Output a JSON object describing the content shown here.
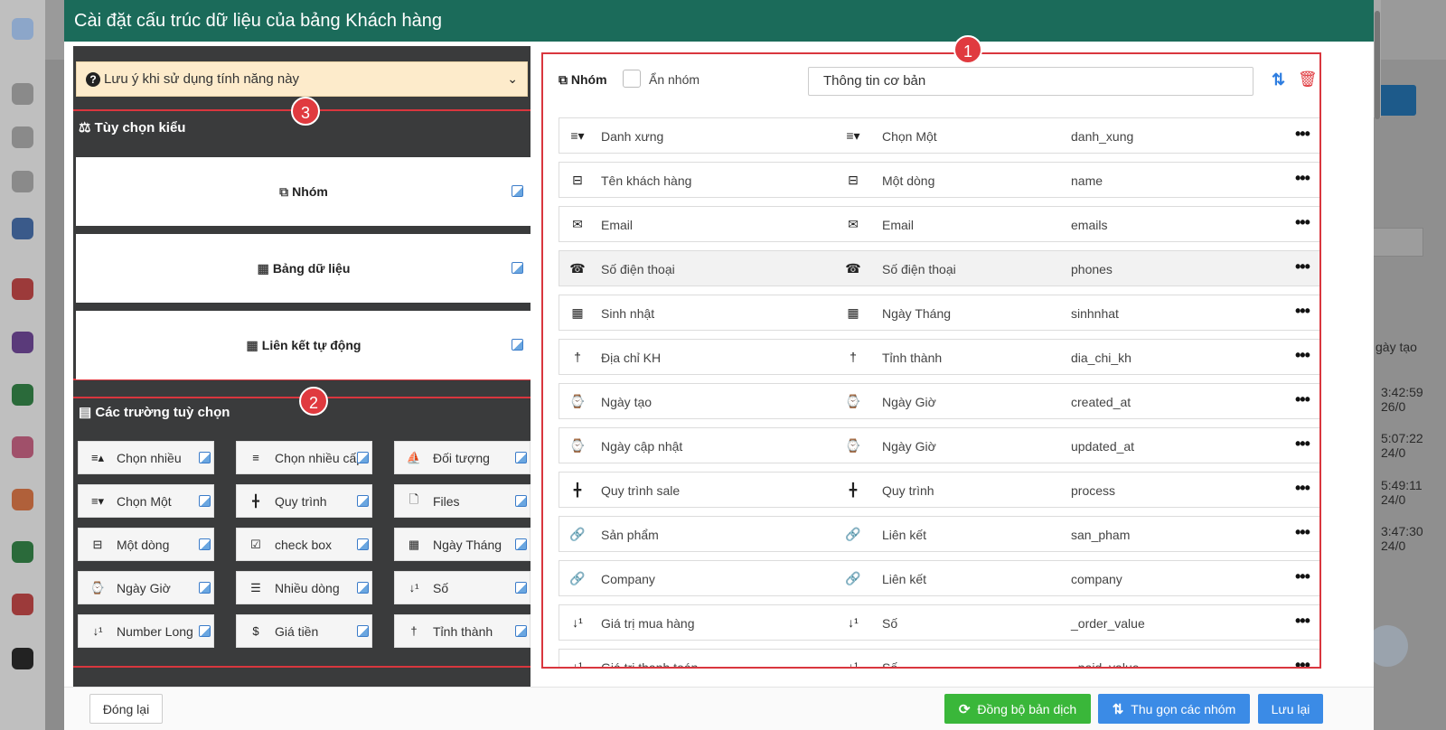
{
  "modal": {
    "title": "Cài đặt cấu trúc dữ liệu của bảng Khách hàng"
  },
  "left_panel": {
    "note": "Lưu ý khi sử dụng tính năng này",
    "type_options": {
      "title": "Tùy chọn kiểu",
      "badge": "3",
      "items": [
        {
          "label": "Nhóm",
          "icon": "copy-icon"
        },
        {
          "label": "Bảng dữ liệu",
          "icon": "table-icon"
        },
        {
          "label": "Liên kết tự động",
          "icon": "table-icon"
        }
      ]
    },
    "custom_fields": {
      "title": "Các trường tuỳ chọn",
      "badge": "2",
      "items": [
        {
          "label": "Chọn nhiều",
          "icon": "multi-select-icon"
        },
        {
          "label": "Chọn nhiều cấp",
          "icon": "list-icon"
        },
        {
          "label": "Đối tượng",
          "icon": "sailboat-icon"
        },
        {
          "label": "Chọn Một",
          "icon": "single-select-icon"
        },
        {
          "label": "Quy trình",
          "icon": "process-icon"
        },
        {
          "label": "Files",
          "icon": "file-icon"
        },
        {
          "label": "Một dòng",
          "icon": "single-line-icon"
        },
        {
          "label": "check box",
          "icon": "checkbox-icon"
        },
        {
          "label": "Ngày Tháng",
          "icon": "calendar-icon"
        },
        {
          "label": "Ngày Giờ",
          "icon": "watch-icon"
        },
        {
          "label": "Nhiều dòng",
          "icon": "multi-line-icon"
        },
        {
          "label": "Số",
          "icon": "number-icon"
        },
        {
          "label": "Number Long",
          "icon": "number-icon"
        },
        {
          "label": "Giá tiền",
          "icon": "dollar-icon"
        },
        {
          "label": "Tỉnh thành",
          "icon": "signpost-icon"
        }
      ]
    }
  },
  "right_panel": {
    "badge": "1",
    "group_label": "Nhóm",
    "hide_group_label": "Ẩn nhóm",
    "group_name": "Thông tin cơ bản",
    "rows": [
      {
        "label": "Danh xưng",
        "type": "Chọn Một",
        "key": "danh_xung",
        "icon": "single-select-icon"
      },
      {
        "label": "Tên khách hàng",
        "type": "Một dòng",
        "key": "name",
        "icon": "single-line-icon"
      },
      {
        "label": "Email",
        "type": "Email",
        "key": "emails",
        "icon": "envelope-icon"
      },
      {
        "label": "Số điện thoại",
        "type": "Số điện thoại",
        "key": "phones",
        "icon": "phone-icon"
      },
      {
        "label": "Sinh nhật",
        "type": "Ngày Tháng",
        "key": "sinhnhat",
        "icon": "calendar-icon"
      },
      {
        "label": "Địa chỉ KH",
        "type": "Tỉnh thành",
        "key": "dia_chi_kh",
        "icon": "signpost-icon"
      },
      {
        "label": "Ngày tạo",
        "type": "Ngày Giờ",
        "key": "created_at",
        "icon": "watch-icon"
      },
      {
        "label": "Ngày cập nhật",
        "type": "Ngày Giờ",
        "key": "updated_at",
        "icon": "watch-icon"
      },
      {
        "label": "Quy trình sale",
        "type": "Quy trình",
        "key": "process",
        "icon": "process-icon"
      },
      {
        "label": "Sản phẩm",
        "type": "Liên kết",
        "key": "san_pham",
        "icon": "link-icon"
      },
      {
        "label": "Company",
        "type": "Liên kết",
        "key": "company",
        "icon": "link-icon"
      },
      {
        "label": "Giá trị mua hàng",
        "type": "Số",
        "key": "_order_value",
        "icon": "number-icon"
      },
      {
        "label": "Giá trị thanh toán",
        "type": "Số",
        "key": "_paid_value",
        "icon": "number-icon"
      }
    ]
  },
  "footer": {
    "close": "Đóng lại",
    "sync": "Đồng bộ bản dịch",
    "collapse": "Thu gọn các nhóm",
    "save": "Lưu lại"
  },
  "background": {
    "column_header": "gày tạo",
    "cells": [
      "3:42:59 26/0",
      "5:07:22 24/0",
      "5:49:11 24/0",
      "3:47:30 24/0"
    ]
  },
  "colors": {
    "header": "#1b6b5a",
    "badge": "#e03a3f",
    "accent_blue": "#3b8be6",
    "accent_green": "#3ab73a",
    "note_bg": "#fdebcb",
    "panel_dark": "#3a3b3c"
  }
}
